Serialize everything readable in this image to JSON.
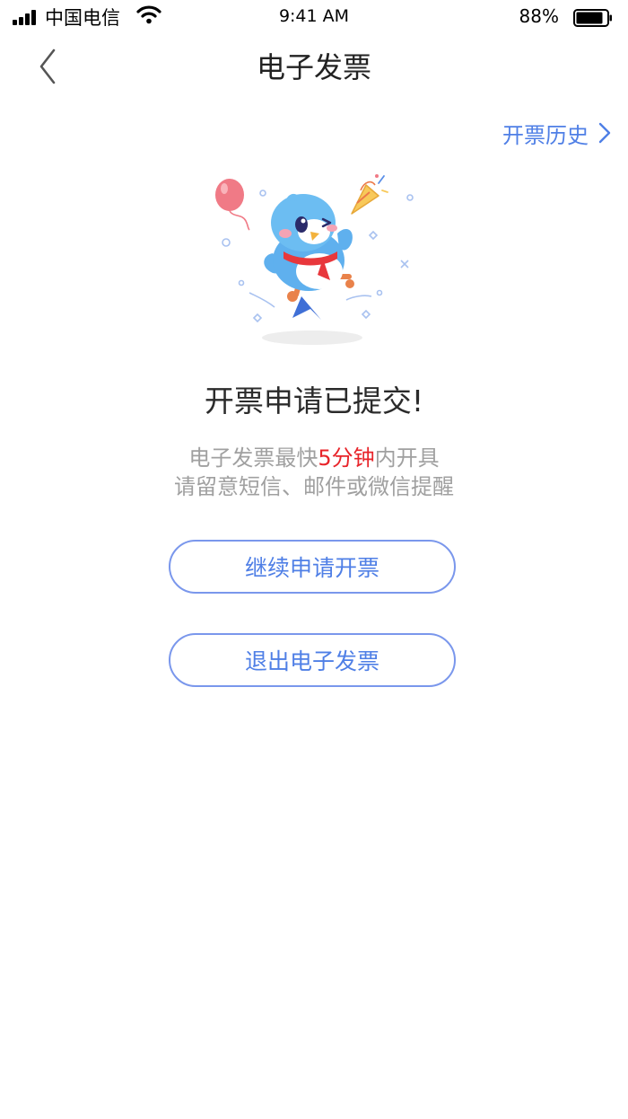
{
  "status_bar": {
    "carrier": "中国电信",
    "time": "9:41 AM",
    "battery": "88%",
    "battery_level": 0.88
  },
  "nav": {
    "title": "电子发票",
    "back_icon": "chevron-left-icon"
  },
  "history_link": {
    "label": "开票历史",
    "icon": "chevron-right-icon"
  },
  "illustration": {
    "subject": "celebrating-bird-mascot"
  },
  "result": {
    "headline": "开票申请已提交!",
    "desc_line1_prefix": "电子发票最快",
    "desc_line1_highlight": "5分钟",
    "desc_line1_suffix": "内开具",
    "desc_line2": "请留意短信、邮件或微信提醒"
  },
  "buttons": {
    "continue_label": "继续申请开票",
    "exit_label": "退出电子发票"
  },
  "colors": {
    "accent": "#4f7fe6",
    "button_border": "#7a97ec",
    "highlight": "#e8242a",
    "secondary_text": "#a0a0a0"
  }
}
